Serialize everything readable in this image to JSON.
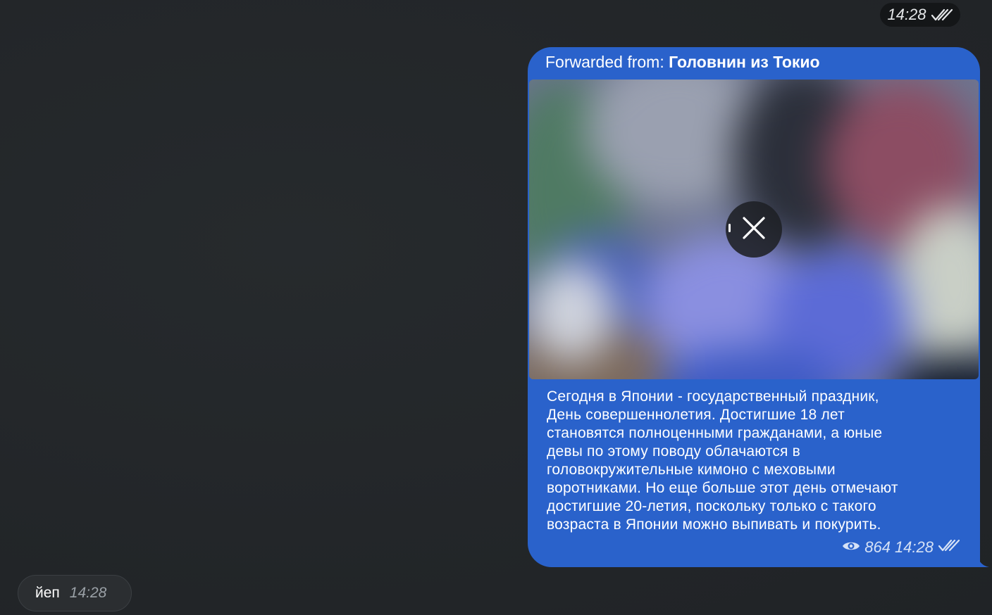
{
  "top_time": "14:28",
  "forwarded": {
    "prefix": "Forwarded from: ",
    "name": "Головнин из Токио",
    "text": "Сегодня в Японии - государственный праздник,\nДень совершеннолетия. Достигшие 18 лет\nстановятся полноценными гражданами, а юные\nдевы по этому поводу облачаются в\nголовокружительные кимоно с меховыми\nворотниками. Но еще больше этот день отмечают\nдостигшие 20-летия, поскольку только с такого\nвозраста в Японии можно выпивать и покурить.",
    "views": "864",
    "time": "14:28"
  },
  "incoming": {
    "text": "йеп",
    "time": "14:28"
  },
  "icons": {
    "read": "double-check-icon",
    "views": "eye-icon",
    "cancel": "close-icon"
  },
  "colors": {
    "outgoing_bubble": "#2a62cb",
    "background": "#232629",
    "incoming_bubble": "#2b2e31"
  }
}
